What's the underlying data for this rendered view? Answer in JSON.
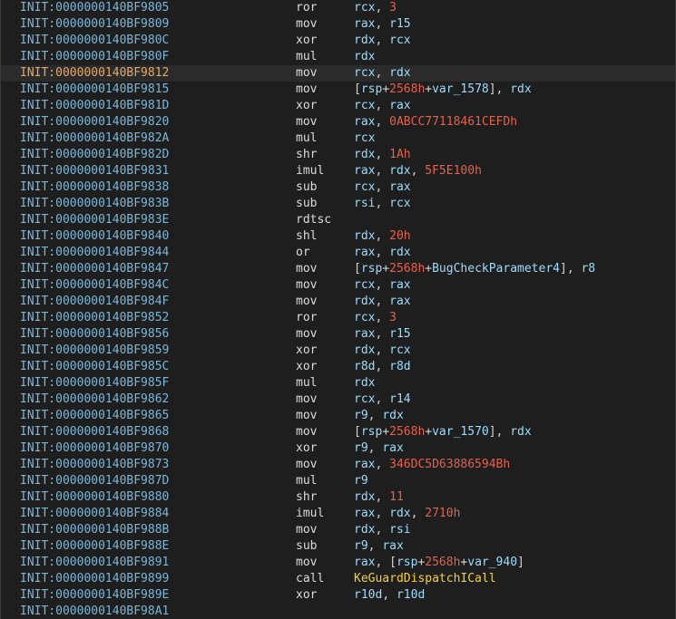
{
  "colors": {
    "background": "#1e1e1e",
    "address": "#7cb6d8",
    "address_highlight": "#e6a86a",
    "mnemonic": "#dcdcdc",
    "register": "#9cdcfe",
    "number": "#e2624d",
    "function": "#f5d142"
  },
  "lines": [
    {
      "addr": "INIT:0000000140BF9805",
      "mn": "ror",
      "ops": [
        [
          "rcx",
          "reg"
        ],
        [
          ", ",
          "punc"
        ],
        [
          "3",
          "num"
        ]
      ]
    },
    {
      "addr": "INIT:0000000140BF9809",
      "mn": "mov",
      "ops": [
        [
          "rax",
          "reg"
        ],
        [
          ", ",
          "punc"
        ],
        [
          "r15",
          "reg"
        ]
      ]
    },
    {
      "addr": "INIT:0000000140BF980C",
      "mn": "xor",
      "ops": [
        [
          "rdx",
          "reg"
        ],
        [
          ", ",
          "punc"
        ],
        [
          "rcx",
          "reg"
        ]
      ]
    },
    {
      "addr": "INIT:0000000140BF980F",
      "mn": "mul",
      "ops": [
        [
          "rdx",
          "reg"
        ]
      ]
    },
    {
      "addr": "INIT:0000000140BF9812",
      "mn": "mov",
      "ops": [
        [
          "rcx",
          "reg"
        ],
        [
          ", ",
          "punc"
        ],
        [
          "rdx",
          "reg"
        ]
      ],
      "highlight": true
    },
    {
      "addr": "INIT:0000000140BF9815",
      "mn": "mov",
      "ops": [
        [
          "[",
          "punc"
        ],
        [
          "rsp",
          "reg"
        ],
        [
          "+",
          "punc"
        ],
        [
          "2568h",
          "num"
        ],
        [
          "+",
          "punc"
        ],
        [
          "var_1578",
          "name"
        ],
        [
          "], ",
          "punc"
        ],
        [
          "rdx",
          "reg"
        ]
      ]
    },
    {
      "addr": "INIT:0000000140BF981D",
      "mn": "xor",
      "ops": [
        [
          "rcx",
          "reg"
        ],
        [
          ", ",
          "punc"
        ],
        [
          "rax",
          "reg"
        ]
      ]
    },
    {
      "addr": "INIT:0000000140BF9820",
      "mn": "mov",
      "ops": [
        [
          "rax",
          "reg"
        ],
        [
          ", ",
          "punc"
        ],
        [
          "0ABCC77118461CEFDh",
          "num"
        ]
      ]
    },
    {
      "addr": "INIT:0000000140BF982A",
      "mn": "mul",
      "ops": [
        [
          "rcx",
          "reg"
        ]
      ]
    },
    {
      "addr": "INIT:0000000140BF982D",
      "mn": "shr",
      "ops": [
        [
          "rdx",
          "reg"
        ],
        [
          ", ",
          "punc"
        ],
        [
          "1Ah",
          "num"
        ]
      ]
    },
    {
      "addr": "INIT:0000000140BF9831",
      "mn": "imul",
      "ops": [
        [
          "rax",
          "reg"
        ],
        [
          ", ",
          "punc"
        ],
        [
          "rdx",
          "reg"
        ],
        [
          ", ",
          "punc"
        ],
        [
          "5F5E100h",
          "num"
        ]
      ]
    },
    {
      "addr": "INIT:0000000140BF9838",
      "mn": "sub",
      "ops": [
        [
          "rcx",
          "reg"
        ],
        [
          ", ",
          "punc"
        ],
        [
          "rax",
          "reg"
        ]
      ]
    },
    {
      "addr": "INIT:0000000140BF983B",
      "mn": "sub",
      "ops": [
        [
          "rsi",
          "reg"
        ],
        [
          ", ",
          "punc"
        ],
        [
          "rcx",
          "reg"
        ]
      ]
    },
    {
      "addr": "INIT:0000000140BF983E",
      "mn": "rdtsc",
      "ops": []
    },
    {
      "addr": "INIT:0000000140BF9840",
      "mn": "shl",
      "ops": [
        [
          "rdx",
          "reg"
        ],
        [
          ", ",
          "punc"
        ],
        [
          "20h",
          "num"
        ]
      ]
    },
    {
      "addr": "INIT:0000000140BF9844",
      "mn": "or",
      "ops": [
        [
          "rax",
          "reg"
        ],
        [
          ", ",
          "punc"
        ],
        [
          "rdx",
          "reg"
        ]
      ]
    },
    {
      "addr": "INIT:0000000140BF9847",
      "mn": "mov",
      "ops": [
        [
          "[",
          "punc"
        ],
        [
          "rsp",
          "reg"
        ],
        [
          "+",
          "punc"
        ],
        [
          "2568h",
          "num"
        ],
        [
          "+",
          "punc"
        ],
        [
          "BugCheckParameter4",
          "name"
        ],
        [
          "], ",
          "punc"
        ],
        [
          "r8",
          "reg"
        ]
      ]
    },
    {
      "addr": "INIT:0000000140BF984C",
      "mn": "mov",
      "ops": [
        [
          "rcx",
          "reg"
        ],
        [
          ", ",
          "punc"
        ],
        [
          "rax",
          "reg"
        ]
      ]
    },
    {
      "addr": "INIT:0000000140BF984F",
      "mn": "mov",
      "ops": [
        [
          "rdx",
          "reg"
        ],
        [
          ", ",
          "punc"
        ],
        [
          "rax",
          "reg"
        ]
      ]
    },
    {
      "addr": "INIT:0000000140BF9852",
      "mn": "ror",
      "ops": [
        [
          "rcx",
          "reg"
        ],
        [
          ", ",
          "punc"
        ],
        [
          "3",
          "num"
        ]
      ]
    },
    {
      "addr": "INIT:0000000140BF9856",
      "mn": "mov",
      "ops": [
        [
          "rax",
          "reg"
        ],
        [
          ", ",
          "punc"
        ],
        [
          "r15",
          "reg"
        ]
      ]
    },
    {
      "addr": "INIT:0000000140BF9859",
      "mn": "xor",
      "ops": [
        [
          "rdx",
          "reg"
        ],
        [
          ", ",
          "punc"
        ],
        [
          "rcx",
          "reg"
        ]
      ]
    },
    {
      "addr": "INIT:0000000140BF985C",
      "mn": "xor",
      "ops": [
        [
          "r8d",
          "reg"
        ],
        [
          ", ",
          "punc"
        ],
        [
          "r8d",
          "reg"
        ]
      ]
    },
    {
      "addr": "INIT:0000000140BF985F",
      "mn": "mul",
      "ops": [
        [
          "rdx",
          "reg"
        ]
      ]
    },
    {
      "addr": "INIT:0000000140BF9862",
      "mn": "mov",
      "ops": [
        [
          "rcx",
          "reg"
        ],
        [
          ", ",
          "punc"
        ],
        [
          "r14",
          "reg"
        ]
      ]
    },
    {
      "addr": "INIT:0000000140BF9865",
      "mn": "mov",
      "ops": [
        [
          "r9",
          "reg"
        ],
        [
          ", ",
          "punc"
        ],
        [
          "rdx",
          "reg"
        ]
      ]
    },
    {
      "addr": "INIT:0000000140BF9868",
      "mn": "mov",
      "ops": [
        [
          "[",
          "punc"
        ],
        [
          "rsp",
          "reg"
        ],
        [
          "+",
          "punc"
        ],
        [
          "2568h",
          "num"
        ],
        [
          "+",
          "punc"
        ],
        [
          "var_1570",
          "name"
        ],
        [
          "], ",
          "punc"
        ],
        [
          "rdx",
          "reg"
        ]
      ]
    },
    {
      "addr": "INIT:0000000140BF9870",
      "mn": "xor",
      "ops": [
        [
          "r9",
          "reg"
        ],
        [
          ", ",
          "punc"
        ],
        [
          "rax",
          "reg"
        ]
      ]
    },
    {
      "addr": "INIT:0000000140BF9873",
      "mn": "mov",
      "ops": [
        [
          "rax",
          "reg"
        ],
        [
          ", ",
          "punc"
        ],
        [
          "346DC5D63886594Bh",
          "num"
        ]
      ]
    },
    {
      "addr": "INIT:0000000140BF987D",
      "mn": "mul",
      "ops": [
        [
          "r9",
          "reg"
        ]
      ]
    },
    {
      "addr": "INIT:0000000140BF9880",
      "mn": "shr",
      "ops": [
        [
          "rdx",
          "reg"
        ],
        [
          ", ",
          "punc"
        ],
        [
          "11",
          "num"
        ]
      ]
    },
    {
      "addr": "INIT:0000000140BF9884",
      "mn": "imul",
      "ops": [
        [
          "rax",
          "reg"
        ],
        [
          ", ",
          "punc"
        ],
        [
          "rdx",
          "reg"
        ],
        [
          ", ",
          "punc"
        ],
        [
          "2710h",
          "num"
        ]
      ]
    },
    {
      "addr": "INIT:0000000140BF988B",
      "mn": "mov",
      "ops": [
        [
          "rdx",
          "reg"
        ],
        [
          ", ",
          "punc"
        ],
        [
          "rsi",
          "reg"
        ]
      ]
    },
    {
      "addr": "INIT:0000000140BF988E",
      "mn": "sub",
      "ops": [
        [
          "r9",
          "reg"
        ],
        [
          ", ",
          "punc"
        ],
        [
          "rax",
          "reg"
        ]
      ]
    },
    {
      "addr": "INIT:0000000140BF9891",
      "mn": "mov",
      "ops": [
        [
          "rax",
          "reg"
        ],
        [
          ", ",
          "punc"
        ],
        [
          "[",
          "punc"
        ],
        [
          "rsp",
          "reg"
        ],
        [
          "+",
          "punc"
        ],
        [
          "2568h",
          "num"
        ],
        [
          "+",
          "punc"
        ],
        [
          "var_940",
          "name"
        ],
        [
          "]",
          "punc"
        ]
      ]
    },
    {
      "addr": "INIT:0000000140BF9899",
      "mn": "call",
      "ops": [
        [
          "KeGuardDispatchICall",
          "func"
        ]
      ]
    },
    {
      "addr": "INIT:0000000140BF989E",
      "mn": "xor",
      "ops": [
        [
          "r10d",
          "reg"
        ],
        [
          ", ",
          "punc"
        ],
        [
          "r10d",
          "reg"
        ]
      ]
    },
    {
      "addr": "INIT:0000000140BF98A1",
      "mn": "",
      "ops": []
    }
  ]
}
